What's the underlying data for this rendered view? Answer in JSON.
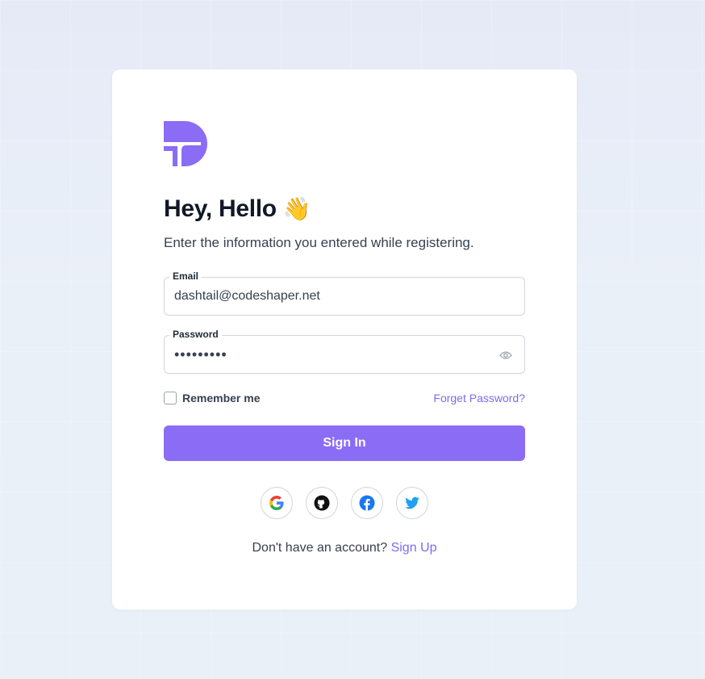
{
  "title": "Hey, Hello",
  "title_emoji": "👋",
  "subtitle": "Enter the information you entered while registering.",
  "email": {
    "label": "Email",
    "value": "dashtail@codeshaper.net"
  },
  "password": {
    "label": "Password",
    "masked_value": "•••••••••"
  },
  "remember": {
    "label": "Remember me",
    "checked": false
  },
  "forget_label": "Forget Password?",
  "signin_label": "Sign In",
  "social_icons": [
    "google-icon",
    "github-icon",
    "facebook-icon",
    "twitter-icon"
  ],
  "signup": {
    "prompt": "Don't have an account?",
    "link": "Sign Up"
  },
  "colors": {
    "accent": "#8b6cf5",
    "link": "#7c6cf0",
    "title": "#111827"
  }
}
